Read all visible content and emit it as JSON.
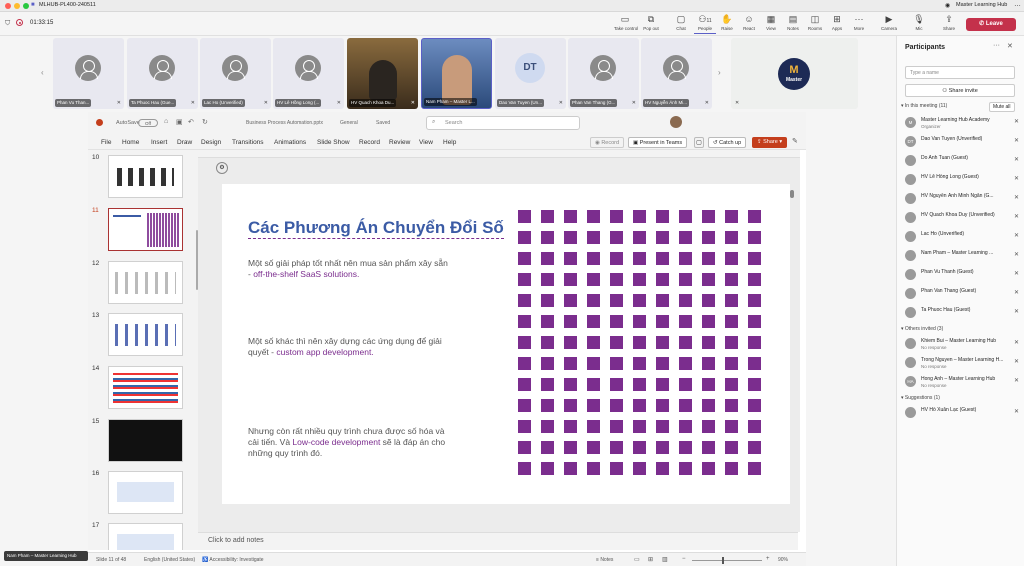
{
  "titlebar": {
    "app_title": "MLHUB-PL400-240511",
    "right_title": "Master Learning Hub",
    "timer": "01:33:15"
  },
  "toolbar": {
    "take_control": "Take control",
    "pop_out": "Pop out",
    "chat": "Chat",
    "people": "People",
    "people_count": "11",
    "raise": "Raise",
    "react": "React",
    "view": "View",
    "notes": "Notes",
    "rooms": "Rooms",
    "apps": "Apps",
    "more": "More",
    "camera": "Camera",
    "mic": "Mic",
    "share": "Share",
    "leave": "Leave"
  },
  "strip": {
    "tiles": [
      {
        "name": "Phan Vu Than..."
      },
      {
        "name": "Ta Phuoc Hau (Gue..."
      },
      {
        "name": "Lac Ho (Unverified)"
      },
      {
        "name": "HV Lê Hồng Long (..."
      },
      {
        "name": "HV Quach Khoa Du..."
      },
      {
        "name": "Nam Pham – Master L..."
      },
      {
        "name": "Dao Van Tuyen (Un..."
      },
      {
        "name": "Phan Van Thang (G..."
      },
      {
        "name": "HV Nguyễn Ánh Mi..."
      }
    ],
    "dt_initials": "DT",
    "logo_text": "Master"
  },
  "ppt": {
    "autosave": "AutoSave",
    "autosave_state": "Off",
    "filename": "Business Process Automation.pptx",
    "sensitivity": "General",
    "saved": "Saved",
    "search_placeholder": "Search",
    "menu": [
      "File",
      "Home",
      "Insert",
      "Draw",
      "Design",
      "Transitions",
      "Animations",
      "Slide Show",
      "Record",
      "Review",
      "View",
      "Help"
    ],
    "record_btn": "Record",
    "present_teams": "Present in Teams",
    "catch_up": "Catch up",
    "share": "Share",
    "slide_numbers": [
      "10",
      "11",
      "12",
      "13",
      "14",
      "15",
      "16",
      "17"
    ],
    "slide": {
      "title": "Các Phương Án Chuyển Đổi Số",
      "p1": "Một số giải pháp tốt nhất nên mua sản phẩm xây sẵn - ",
      "p1_hl": "off-the-shelf SaaS solutions.",
      "p2": "Một số khác thì nên xây dựng các ứng dụng để giải quyết - ",
      "p2_hl": "custom app development.",
      "p3": "Nhưng còn rất nhiều quy trình chưa được số hóa và cải tiến. Và ",
      "p3_hl": "Low-code development",
      "p3_end": " sẽ là đáp án cho những quy trình đó.",
      "grid_color": "#7b2d8e",
      "title_color": "#3b5ba5",
      "accent_color": "#7b2d8e"
    },
    "notes_placeholder": "Click to add notes",
    "status": {
      "slide_of": "Slide 11 of 48",
      "lang": "English (United States)",
      "accessibility": "Accessibility: Investigate",
      "notes": "Notes",
      "zoom": "90%"
    }
  },
  "panel": {
    "title": "Participants",
    "search_placeholder": "Type a name",
    "share_invite": "Share invite",
    "in_meeting_label": "In this meeting (11)",
    "mute_all": "Mute all",
    "in_meeting": [
      {
        "name": "Master Learning Hub Academy",
        "sub": "Organizer",
        "init": "M"
      },
      {
        "name": "Dao Van Tuyen (Unverified)",
        "init": "DT"
      },
      {
        "name": "Do Anh Tuan (Guest)",
        "init": ""
      },
      {
        "name": "HV Lê Hồng Long (Guest)",
        "init": ""
      },
      {
        "name": "HV Nguyễn Ánh Minh Ngân (G...",
        "init": ""
      },
      {
        "name": "HV Quach Khoa Duy (Unverified)",
        "init": ""
      },
      {
        "name": "Lac Ho (Unverified)",
        "init": ""
      },
      {
        "name": "Nam Pham – Master Learning ...",
        "init": ""
      },
      {
        "name": "Phan Vu Thanh (Guest)",
        "init": ""
      },
      {
        "name": "Phan Van Thang (Guest)",
        "init": ""
      },
      {
        "name": "Ta Phuoc Hau (Guest)",
        "init": ""
      }
    ],
    "others_label": "Others invited (3)",
    "others": [
      {
        "name": "Khiem Bui – Master Learning Hub",
        "sub": "No response",
        "init": ""
      },
      {
        "name": "Trong Nguyen – Master Learning H...",
        "sub": "No response",
        "init": ""
      },
      {
        "name": "Hong Anh – Master Learning Hub",
        "sub": "No response",
        "init": "HA"
      }
    ],
    "suggestions_label": "Suggestions (1)",
    "suggestions": [
      {
        "name": "HV Hồ Xuân Lạc (Guest)",
        "init": ""
      }
    ]
  },
  "bottom_name": "Nam Pham – Master Learning Hub"
}
